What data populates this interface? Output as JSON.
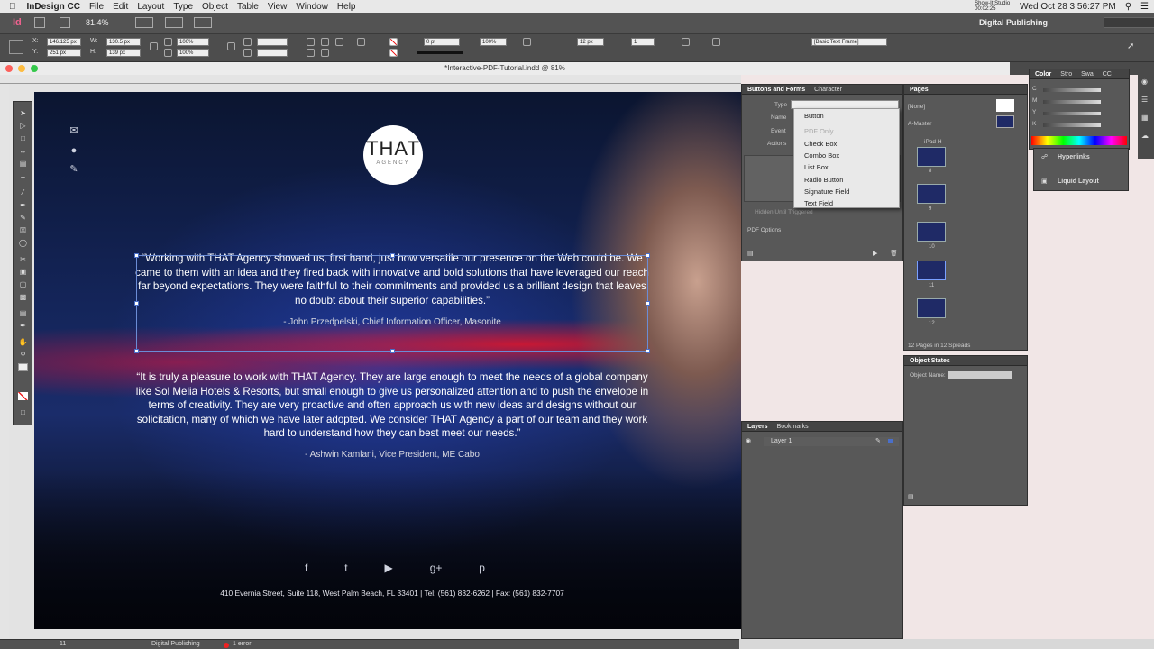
{
  "menubar": {
    "apple": "",
    "app": "InDesign CC",
    "items": [
      "File",
      "Edit",
      "Layout",
      "Type",
      "Object",
      "Table",
      "View",
      "Window",
      "Help"
    ],
    "datetime": "Wed Oct 28  3:56:27 PM",
    "recorder": "Show-It Studio 00:02:25"
  },
  "appbar": {
    "logo": "Id",
    "zoom": "81.4%",
    "workspace": "Digital Publishing"
  },
  "controlbar": {
    "x": "146.125 px",
    "y": "251 px",
    "w": "130.5 px",
    "h": "139 px",
    "stroke": "0 pt",
    "opacity": "100%",
    "frame_style": "[Basic Text Frame]",
    "pct1": "100%",
    "pct2": "100%",
    "pt": "12 px",
    "n1": "1"
  },
  "document": {
    "title": "*Interactive-PDF-Tutorial.indd @ 81%"
  },
  "page": {
    "logo_main": "THAT",
    "logo_sub": "AGENCY",
    "quote1": "“Working with THAT Agency showed us, first hand, just how versatile our presence on the Web could be. We came to them with an idea and they fired back with innovative and bold solutions that have leveraged our reach far beyond expectations. They were faithful to their commitments and provided us a brilliant design that leaves no doubt about their superior capabilities.”",
    "attrib1": "- John Przedpelski, Chief Information Officer, Masonite",
    "quote2": "“It is truly a pleasure to work with THAT Agency. They are large enough to meet the needs of a global company like Sol Melia Hotels & Resorts, but small enough to give us personalized attention and to push the envelope in terms of creativity. They are very proactive and often approach us with new ideas and designs without our solicitation, many of which we have later adopted. We consider THAT Agency a part of our team and they work hard to understand how they can best meet our needs.”",
    "attrib2": "- Ashwin Kamlani, Vice President, ME Cabo",
    "address": "410 Evernia Street, Suite 118, West Palm Beach, FL 33401  |  Tel: (561) 832-6262  |  Fax: (561) 832-7707",
    "social": [
      "f",
      "t",
      "▶",
      "g+",
      "p"
    ]
  },
  "buttons_panel": {
    "tab1": "Buttons and Forms",
    "tab2": "Character",
    "type_label": "Type",
    "name_label": "Name",
    "event_label": "Event",
    "actions_label": "Actions",
    "hidden_label": "Hidden Until Triggered",
    "pdf_options": "PDF Options"
  },
  "type_dropdown": [
    "Button",
    "PDF Only",
    "Check Box",
    "Combo Box",
    "List Box",
    "Radio Button",
    "Signature Field",
    "Text Field"
  ],
  "pages_panel": {
    "tab": "Pages",
    "none": "[None]",
    "master": "A-Master",
    "device": "iPad H",
    "page_nums": [
      "8",
      "9",
      "10",
      "11",
      "12"
    ],
    "footer": "12 Pages in 12 Spreads"
  },
  "color_panel": {
    "tabs": [
      "Color",
      "Stro",
      "Swa",
      "CC"
    ],
    "labels": [
      "C",
      "M",
      "Y",
      "K"
    ]
  },
  "side_panel": {
    "hyperlinks": "Hyperlinks",
    "liquid": "Liquid Layout"
  },
  "object_states": {
    "tab": "Object States",
    "name_label": "Object Name:"
  },
  "layers_panel": {
    "tab1": "Layers",
    "tab2": "Bookmarks",
    "layer": "Layer 1"
  },
  "statusbar": {
    "page": "11",
    "profile": "Digital Publishing",
    "errors": "1 error"
  }
}
